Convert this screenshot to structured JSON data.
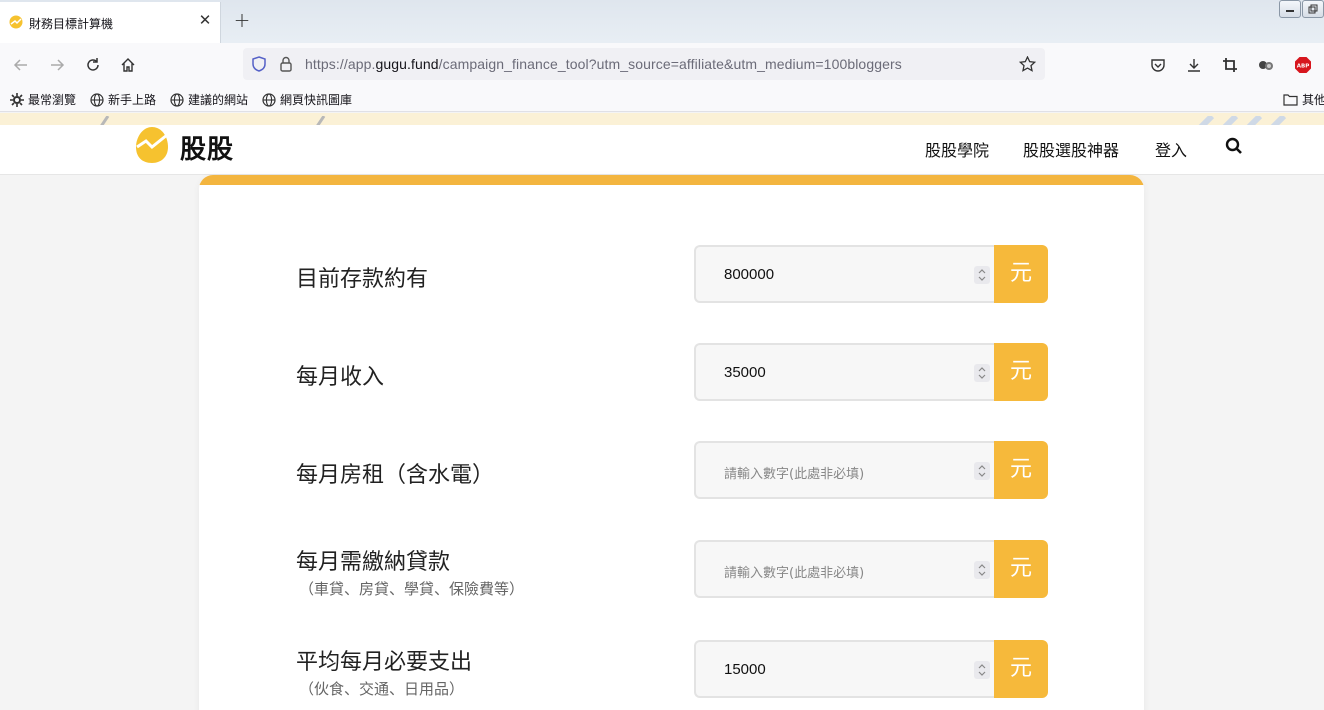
{
  "browser": {
    "tab_title": "財務目標計算機",
    "new_tab_label": "+",
    "close_label": "✕",
    "url_prefix": "https://app.",
    "url_domain": "gugu.fund",
    "url_path": "/campaign_finance_tool?utm_source=affiliate&utm_medium=100bloggers",
    "bookmarks": [
      "最常瀏覽",
      "新手上路",
      "建議的網站",
      "網頁快訊圖庫"
    ],
    "other_bookmarks": "其他",
    "addon_label": "ABP"
  },
  "site": {
    "logo_text": "股股",
    "nav": [
      "股股學院",
      "股股選股神器",
      "登入"
    ],
    "accent_color": "#f6b93b"
  },
  "form": {
    "unit": "元",
    "rows": [
      {
        "label": "目前存款約有",
        "sub": "",
        "value": "800000",
        "placeholder": ""
      },
      {
        "label": "每月收入",
        "sub": "",
        "value": "35000",
        "placeholder": ""
      },
      {
        "label": "每月房租（含水電）",
        "sub": "",
        "value": "",
        "placeholder": "請輸入數字(此處非必填)"
      },
      {
        "label": "每月需繳納貸款",
        "sub": "（車貸、房貸、學貸、保險費等）",
        "value": "",
        "placeholder": "請輸入數字(此處非必填)"
      },
      {
        "label": "平均每月必要支出",
        "sub": "（伙食、交通、日用品）",
        "value": "15000",
        "placeholder": ""
      }
    ]
  }
}
